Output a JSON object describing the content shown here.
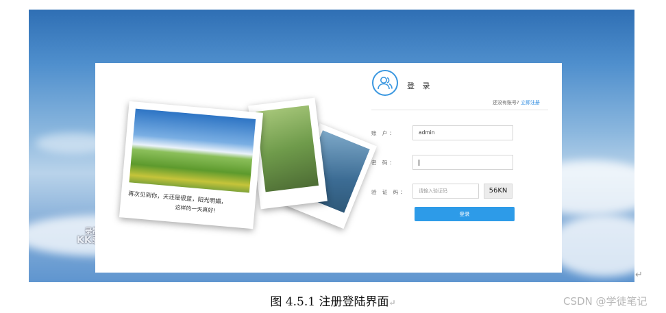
{
  "watermark": {
    "line1": "录制工具",
    "line2": "KK录像机"
  },
  "photo": {
    "caption_line1": "再次见到你，天还是很蓝，阳光明媚，",
    "caption_line2": "这样的一天真好!"
  },
  "login": {
    "title": "登 录",
    "no_account": "还没有账号?",
    "register_link": "立即注册",
    "account_label": "账 户：",
    "account_value": "admin",
    "password_label": "密 码：",
    "captcha_label": "验 证 码：",
    "captcha_placeholder": "请输入验证码",
    "captcha_code": "56KN",
    "submit_label": "登录"
  },
  "figure_caption": "图 4.5.1  注册登陆界面",
  "return_mark": "↵",
  "site_watermark": "CSDN @学徒笔记",
  "colors": {
    "accent": "#2d9be8",
    "link": "#2d8be0",
    "sky": "#4f8fcd"
  }
}
